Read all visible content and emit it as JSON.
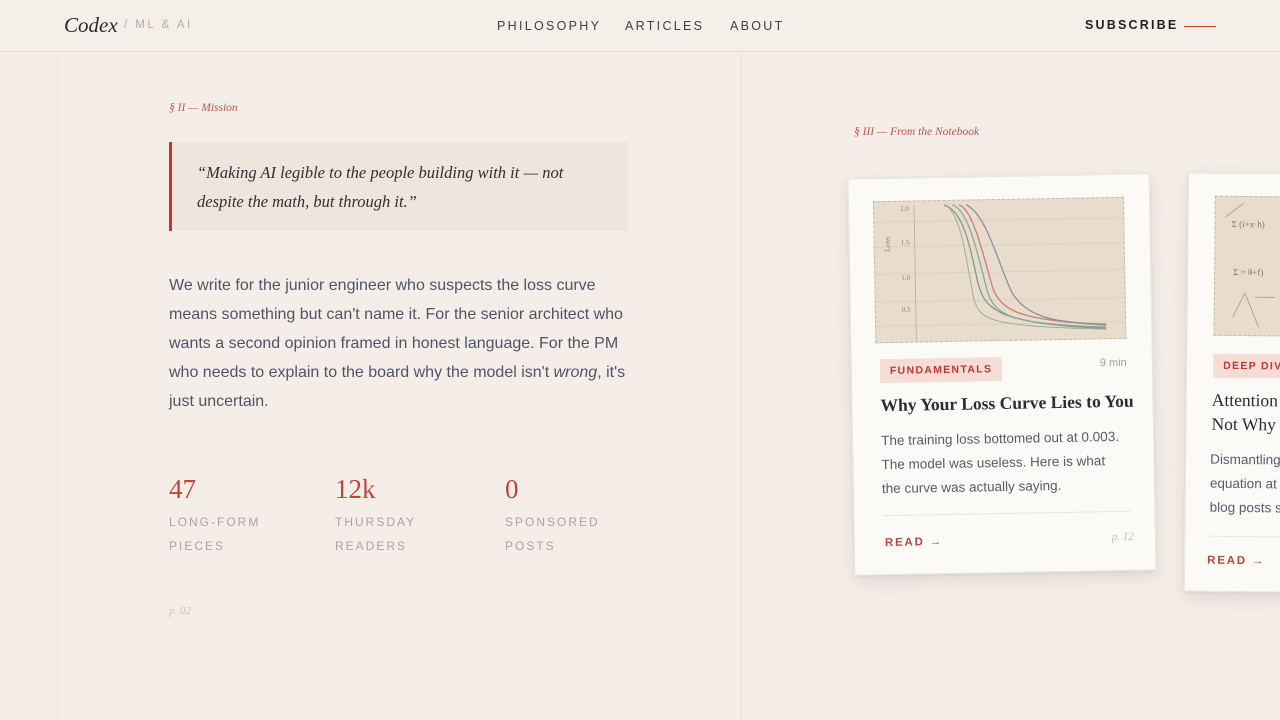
{
  "header": {
    "brand": "Codex",
    "brand_sub": "/ ML & AI",
    "nav": [
      "PHILOSOPHY",
      "ARTICLES",
      "ABOUT"
    ],
    "subscribe": "SUBSCRIBE"
  },
  "mission": {
    "label": "§ II — Mission",
    "quote": "“Making AI legible to the people building with it — not despite the math, but through it.”",
    "body_before": "We write for the junior engineer who suspects the loss curve means something but can't name it. For the senior architect who wants a second opinion framed in honest language. For the PM who needs to explain to the board why the model isn't ",
    "body_em": "wrong",
    "body_after": ", it's just uncertain.",
    "stats": [
      {
        "value": "47",
        "label_1": "LONG-FORM",
        "label_2": "PIECES"
      },
      {
        "value": "12k",
        "label_1": "THURSDAY",
        "label_2": "READERS"
      },
      {
        "value": "0",
        "label_1": "SPONSORED",
        "label_2": "POSTS"
      }
    ],
    "page": "p. 02"
  },
  "notebook": {
    "label": "§ III — From the Notebook",
    "cards": [
      {
        "tag": "FUNDAMENTALS",
        "minutes": "9 min",
        "title": "Why Your Loss Curve Lies to You",
        "desc_1": "The training loss bottomed out at 0.003.",
        "desc_2": "The model was useless. Here is what",
        "desc_3": "the curve was actually saying.",
        "read": "READ →",
        "page": "p. 12",
        "thumb": {
          "axis": "Loss",
          "ticks": [
            "2.0",
            "1.5",
            "1.0",
            "0.5"
          ]
        }
      },
      {
        "tag": "DEEP DIVE",
        "title_1": "Attention",
        "title_2": "Not Why",
        "desc_1": "Dismantling",
        "desc_2": "equation at",
        "desc_3": "blog posts s",
        "read": "READ →",
        "thumb": {
          "formula_1": "Σ (i+x·h)",
          "formula_2": "Σ = θ+f)"
        }
      }
    ]
  },
  "colors": {
    "accent": "#c0392b",
    "paper": "#f5eee8",
    "card": "#fcfaf6"
  }
}
